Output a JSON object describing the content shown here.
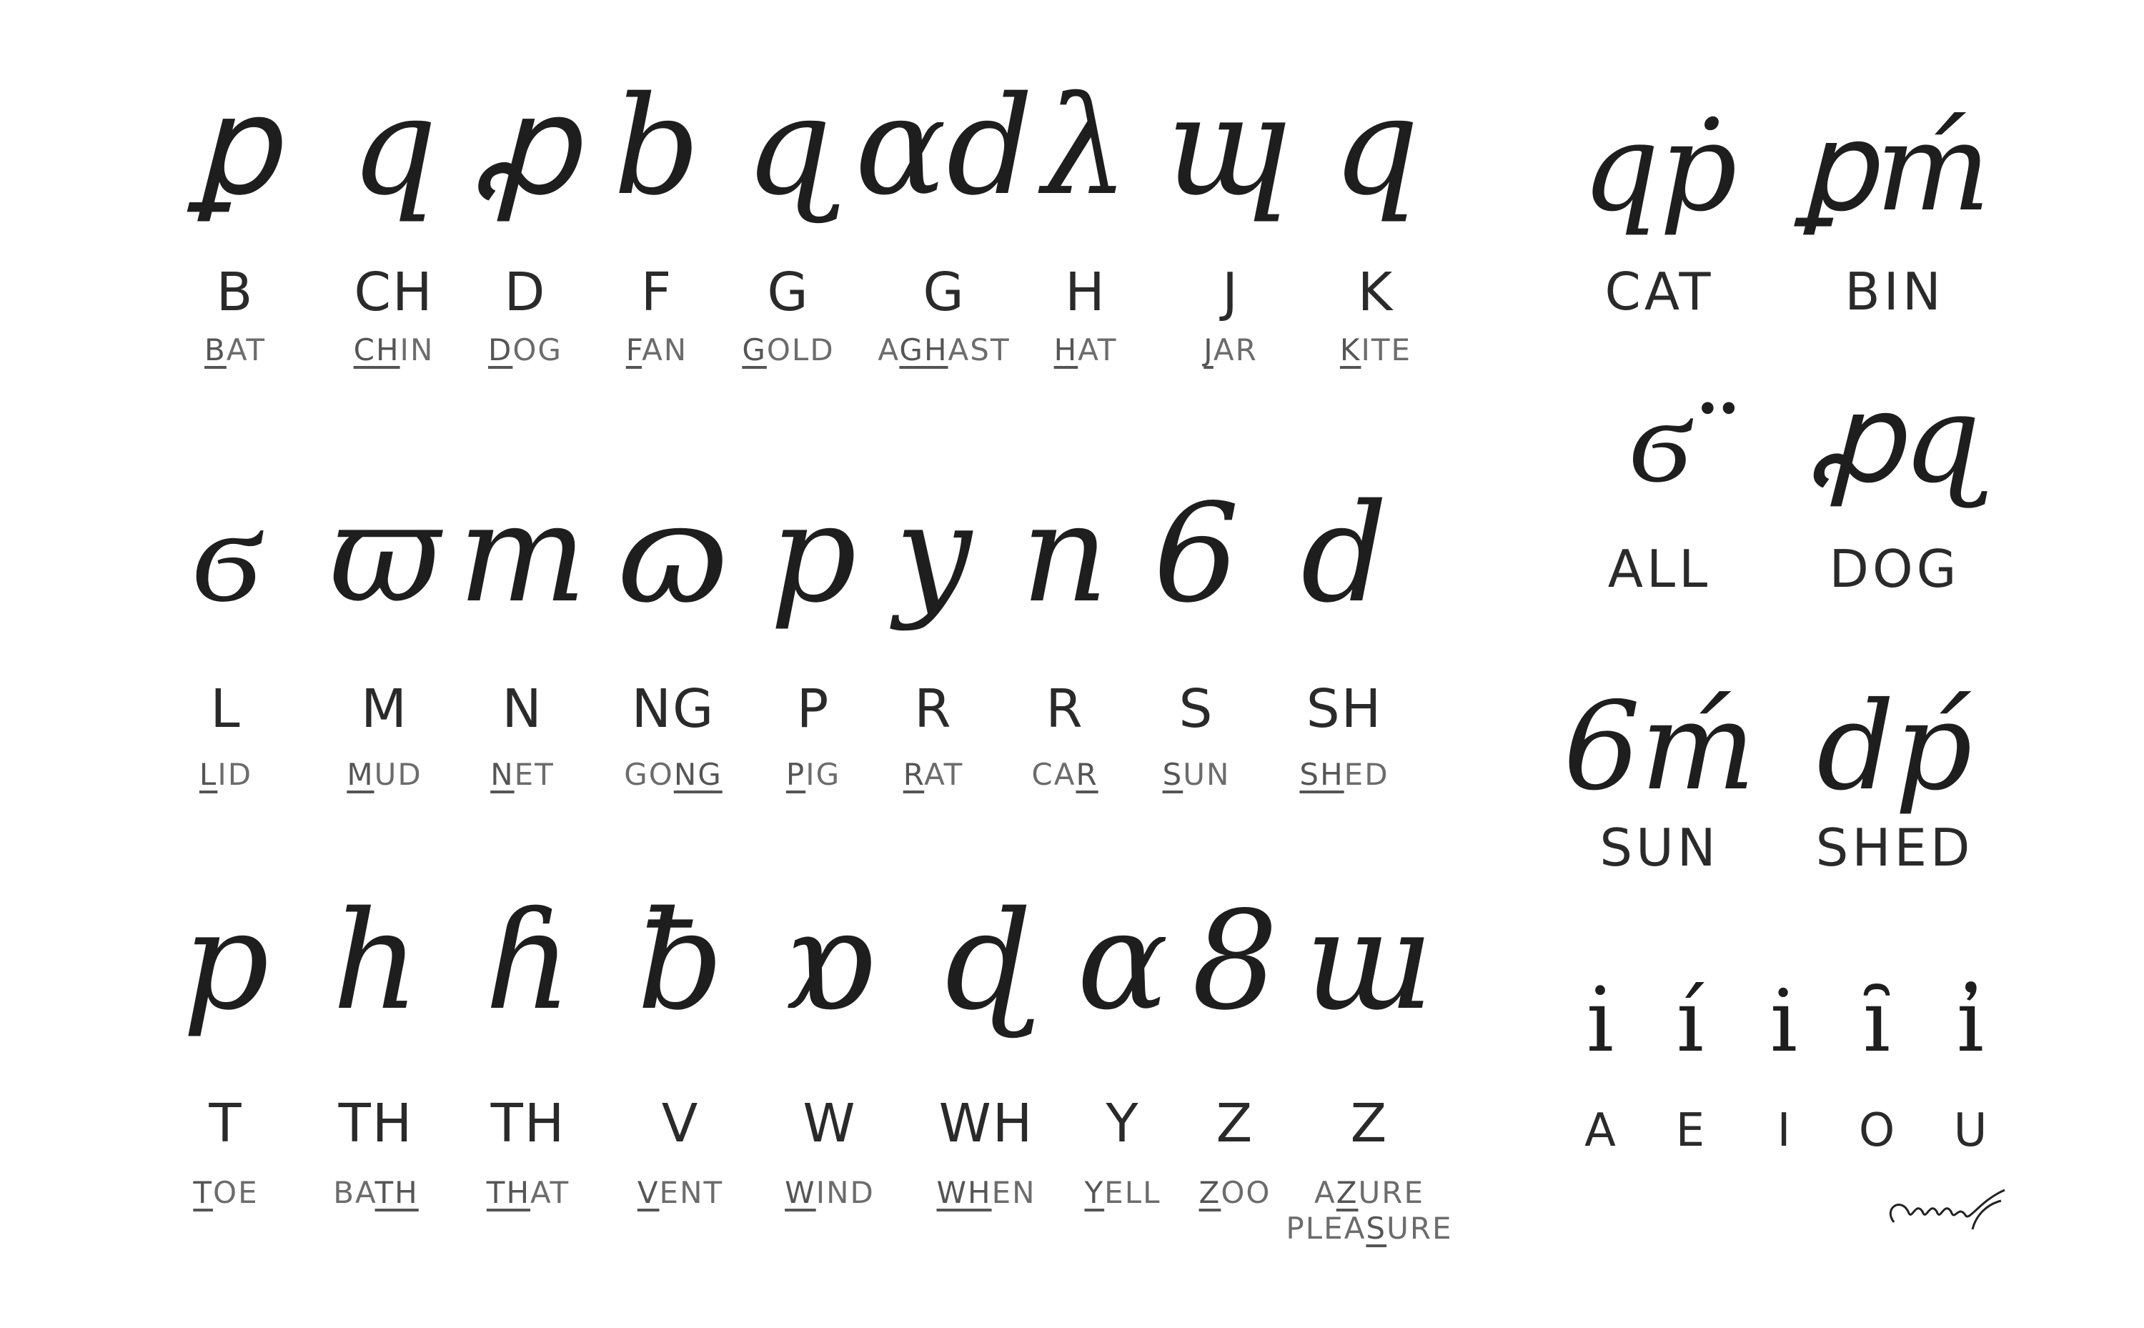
{
  "rows": [
    [
      {
        "glyph": "ꝑ",
        "letter": "B",
        "words": [
          {
            "pre": "",
            "u": "B",
            "post": "AT"
          }
        ]
      },
      {
        "glyph": "q",
        "letter": "CH",
        "words": [
          {
            "pre": "",
            "u": "CH",
            "post": "IN"
          }
        ]
      },
      {
        "glyph": "ꝓ",
        "letter": "D",
        "words": [
          {
            "pre": "",
            "u": "D",
            "post": "OG"
          }
        ]
      },
      {
        "glyph": "b",
        "letter": "F",
        "words": [
          {
            "pre": "",
            "u": "F",
            "post": "AN"
          }
        ]
      },
      {
        "glyph": "ɋ",
        "letter": "G",
        "words": [
          {
            "pre": "",
            "u": "G",
            "post": "OLD"
          }
        ]
      },
      {
        "glyph": "ɑd",
        "letter": "G",
        "words": [
          {
            "pre": "A",
            "u": "GH",
            "post": "AST"
          }
        ]
      },
      {
        "glyph": "λ",
        "letter": "H",
        "words": [
          {
            "pre": "",
            "u": "H",
            "post": "AT"
          }
        ]
      },
      {
        "glyph": "ɰ",
        "letter": "J",
        "words": [
          {
            "pre": "",
            "u": "J",
            "post": "AR"
          }
        ]
      },
      {
        "glyph": "q",
        "letter": "K",
        "words": [
          {
            "pre": "",
            "u": "K",
            "post": "ITE"
          }
        ]
      }
    ],
    [
      {
        "glyph": "ϭ",
        "letter": "L",
        "words": [
          {
            "pre": "",
            "u": "L",
            "post": "ID"
          }
        ]
      },
      {
        "glyph": "ϖ",
        "letter": "M",
        "words": [
          {
            "pre": "",
            "u": "M",
            "post": "UD"
          }
        ]
      },
      {
        "glyph": "m",
        "letter": "N",
        "words": [
          {
            "pre": "",
            "u": "N",
            "post": "ET"
          }
        ]
      },
      {
        "glyph": "ɷ",
        "letter": "NG",
        "words": [
          {
            "pre": "GO",
            "u": "NG",
            "post": ""
          }
        ]
      },
      {
        "glyph": "p",
        "letter": "P",
        "words": [
          {
            "pre": "",
            "u": "P",
            "post": "IG"
          }
        ]
      },
      {
        "glyph": "y",
        "letter": "R",
        "words": [
          {
            "pre": "",
            "u": "R",
            "post": "AT"
          }
        ]
      },
      {
        "glyph": "n",
        "letter": "R",
        "words": [
          {
            "pre": "CA",
            "u": "R",
            "post": ""
          }
        ]
      },
      {
        "glyph": "6",
        "letter": "S",
        "words": [
          {
            "pre": "",
            "u": "S",
            "post": "UN"
          }
        ]
      },
      {
        "glyph": "d",
        "letter": "SH",
        "words": [
          {
            "pre": "",
            "u": "SH",
            "post": "ED"
          }
        ]
      }
    ],
    [
      {
        "glyph": "p",
        "letter": "T",
        "words": [
          {
            "pre": "",
            "u": "T",
            "post": "OE"
          }
        ]
      },
      {
        "glyph": "h",
        "letter": "TH",
        "words": [
          {
            "pre": "BA",
            "u": "TH",
            "post": ""
          }
        ]
      },
      {
        "glyph": "ɦ",
        "letter": "TH",
        "words": [
          {
            "pre": "",
            "u": "TH",
            "post": "AT"
          }
        ]
      },
      {
        "glyph": "ƀ",
        "letter": "V",
        "words": [
          {
            "pre": "",
            "u": "V",
            "post": "ENT"
          }
        ]
      },
      {
        "glyph": "ɒ",
        "letter": "W",
        "words": [
          {
            "pre": "",
            "u": "W",
            "post": "IND"
          }
        ]
      },
      {
        "glyph": "ɖ",
        "letter": "WH",
        "words": [
          {
            "pre": "",
            "u": "WH",
            "post": "EN"
          }
        ]
      },
      {
        "glyph": "ɑ",
        "letter": "Y",
        "words": [
          {
            "pre": "",
            "u": "Y",
            "post": "ELL"
          }
        ]
      },
      {
        "glyph": "8",
        "letter": "Z",
        "words": [
          {
            "pre": "",
            "u": "Z",
            "post": "OO"
          }
        ]
      },
      {
        "glyph": "ɯ",
        "letter": "Z",
        "words": [
          {
            "pre": "A",
            "u": "Z",
            "post": "URE"
          },
          {
            "pre": "PLEA",
            "u": "S",
            "post": "URE"
          }
        ]
      }
    ]
  ],
  "examples": [
    {
      "glyph": "qṗ",
      "word": "CAT"
    },
    {
      "glyph": "ꝑḿ",
      "word": "BIN"
    },
    {
      "glyph": "ϭ̈",
      "word": "ALL"
    },
    {
      "glyph": "ꝓɋ",
      "word": "DOG"
    },
    {
      "glyph": "6ḿ",
      "word": "SUN"
    },
    {
      "glyph": "dṕ",
      "word": "SHED"
    }
  ],
  "vowels": [
    {
      "glyph": "ı̇",
      "letter": "A"
    },
    {
      "glyph": "í",
      "letter": "E"
    },
    {
      "glyph": "i",
      "letter": "I"
    },
    {
      "glyph": "ı̑",
      "letter": "O"
    },
    {
      "glyph": "ı̓",
      "letter": "U"
    }
  ],
  "signature": "signature-mark"
}
